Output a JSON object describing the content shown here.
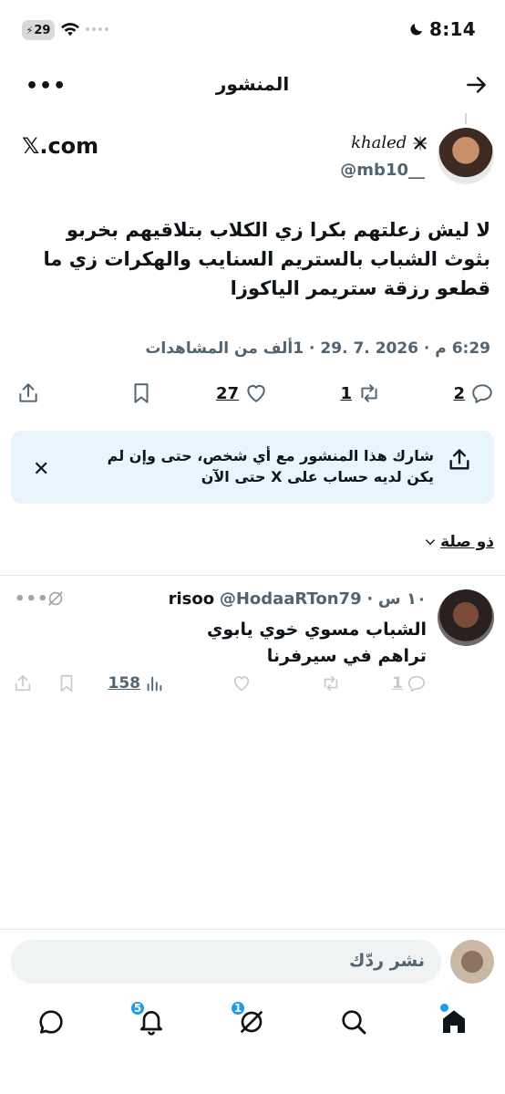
{
  "status_bar": {
    "time": "8:14",
    "battery": "29",
    "icons": [
      "moon-icon",
      "battery-icon",
      "wifi-icon",
      "signal-icon"
    ]
  },
  "header": {
    "title": "المنشور",
    "back_icon": "arrow-right-icon",
    "more_label": "•••"
  },
  "post": {
    "author_name": "khaled",
    "author_handle": "@mb10__",
    "source": "𝕏.com",
    "text_line1": "لا ليش زعلتهم بكرا زي الكلاب بتلاقيهم بخربو",
    "text_line2": "بثوث الشباب  بالستريم السنايب والهكرات زي ما",
    "text_line3": "قطعو رزقة ستريمر الياكوزا",
    "meta": "6:29 م · 2026 .7 .29 · 1ألف من المشاهدات",
    "actions": {
      "replies": "2",
      "reposts": "1",
      "likes": "27"
    }
  },
  "share_tip": {
    "line1": "شارك هذا المنشور مع أي شخص، حتى وإن لم",
    "line2": "يكن لديه حساب على X حتى الآن",
    "close": "✕"
  },
  "relevance": {
    "label": "ذو صلة"
  },
  "reply": {
    "name": "risoo",
    "handle": "@HodaaRTon79",
    "time": "١٠ س",
    "text_line1": "الشباب مسوي خوي يابوي",
    "text_line2": "تراهم في سيرفرنا",
    "more_label": "•••",
    "actions": {
      "replies": "1",
      "views": "158"
    }
  },
  "compose": {
    "placeholder": "نشر ردّك"
  },
  "bottom_nav": {
    "notifications_badge": "5",
    "grok_badge": "1"
  },
  "colors": {
    "accent": "#1d9bf0",
    "text": "#0f1419",
    "muted": "#536471",
    "tip_bg": "#e8f5fd"
  }
}
